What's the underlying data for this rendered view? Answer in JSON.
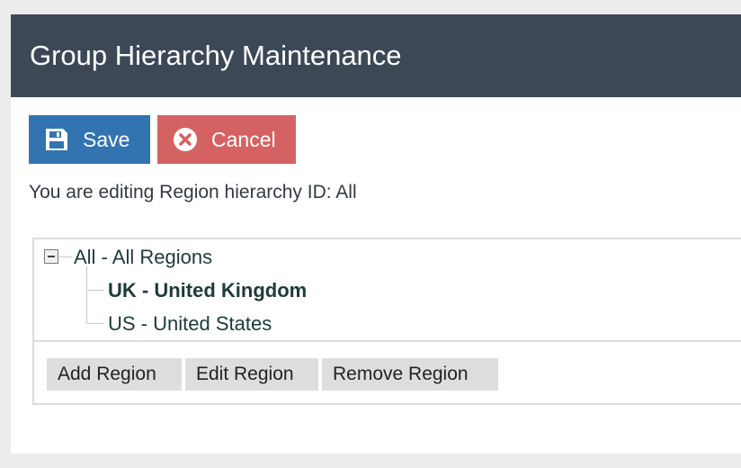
{
  "header": {
    "title": "Group Hierarchy Maintenance"
  },
  "toolbar": {
    "save_label": "Save",
    "cancel_label": "Cancel",
    "save_icon": "floppy-disk-icon",
    "cancel_icon": "x-circle-icon"
  },
  "info": {
    "text": "You are editing Region hierarchy ID: All"
  },
  "tree": {
    "root": {
      "label": "All - All Regions",
      "expanded": true
    },
    "children": [
      {
        "label": "UK - United Kingdom",
        "selected": true
      },
      {
        "label": "US - United States",
        "selected": false
      }
    ]
  },
  "actions": {
    "add_label": "Add Region",
    "edit_label": "Edit Region",
    "remove_label": "Remove Region"
  },
  "colors": {
    "header_bg": "#3c4856",
    "save_bg": "#3274b0",
    "cancel_bg": "#d56262"
  }
}
